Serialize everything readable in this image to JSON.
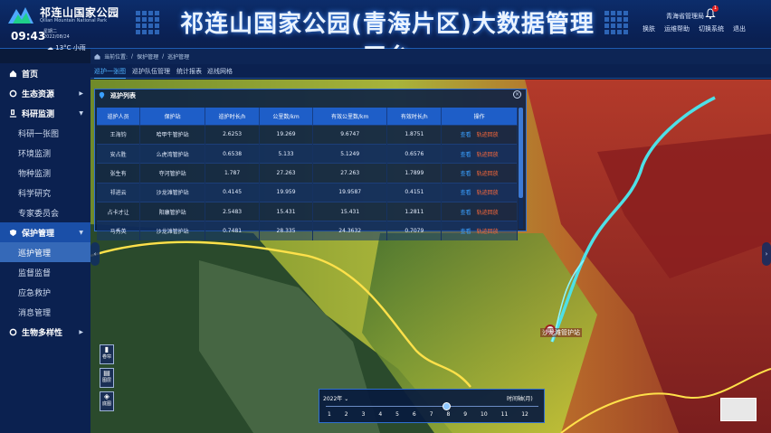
{
  "header": {
    "logo_cn": "祁连山国家公园",
    "logo_en": "Qilian Mountain National Park",
    "time": "09:43",
    "weekday": "星期二",
    "date": "2022/08/24",
    "weather_temp": "13°C",
    "weather_desc": "小雨",
    "title": "祁连山国家公园(青海片区)大数据管理平台",
    "user": "青海省管理局",
    "bell_count": "1",
    "links": [
      "换肤",
      "运维帮助",
      "切换系统",
      "退出"
    ]
  },
  "sidebar": {
    "sections": [
      {
        "label": "首页",
        "icon": "home-icon"
      },
      {
        "label": "生态资源",
        "icon": "gear-icon"
      },
      {
        "label": "科研监测",
        "icon": "microscope-icon"
      },
      {
        "label": "保护管理",
        "icon": "shield-icon"
      },
      {
        "label": "生物多样性",
        "icon": "gear-icon"
      }
    ],
    "research_items": [
      "科研一张图",
      "环境监测",
      "物种监测",
      "科学研究",
      "专家委员会"
    ],
    "protect_items": [
      "巡护管理",
      "监督监督",
      "应急救护",
      "消息管理"
    ]
  },
  "breadcrumb": {
    "prefix": "当前位置:",
    "level1": "保护管理",
    "level2": "巡护管理"
  },
  "tabs": [
    "巡护一张图",
    "巡护队伍管理",
    "统计报表",
    "巡线网格"
  ],
  "panel": {
    "title": "巡护列表",
    "columns": [
      "巡护人员",
      "保护站",
      "巡护时长/h",
      "公里数/km",
      "有效公里数/km",
      "有效时长/h",
      "操作"
    ],
    "rows": [
      [
        "王海钧",
        "哈甲牛管护站",
        "2.6253",
        "19.269",
        "9.6747",
        "1.8751"
      ],
      [
        "安占胜",
        "么虎湾管护站",
        "0.6538",
        "5.133",
        "5.1249",
        "0.6576"
      ],
      [
        "张生有",
        "夺河管护站",
        "1.787",
        "27.263",
        "27.263",
        "1.7899"
      ],
      [
        "祁进云",
        "沙龙滩管护站",
        "0.4145",
        "19.959",
        "19.9587",
        "0.4151"
      ],
      [
        "占卡才让",
        "阳康管护站",
        "2.5483",
        "15.431",
        "15.431",
        "1.2811"
      ],
      [
        "马秀英",
        "沙龙滩管护站",
        "0.7481",
        "28.335",
        "24.3632",
        "0.7079"
      ]
    ],
    "op_view": "查看",
    "op_track": "轨迹回放"
  },
  "map": {
    "tools": [
      "卷帘",
      "图层",
      "底图"
    ],
    "marker_label": "沙龙滩管护站",
    "timeline_year": "2022年",
    "timeline_axis": "时间轴(月)",
    "months": [
      "1",
      "2",
      "3",
      "4",
      "5",
      "6",
      "7",
      "8",
      "9",
      "10",
      "11",
      "12"
    ],
    "selected_month": 8
  },
  "colors": {
    "accent": "#1e5ec8",
    "header": "#0a2258",
    "sidebar": "#0b2150",
    "track": "#ff6a3a"
  }
}
